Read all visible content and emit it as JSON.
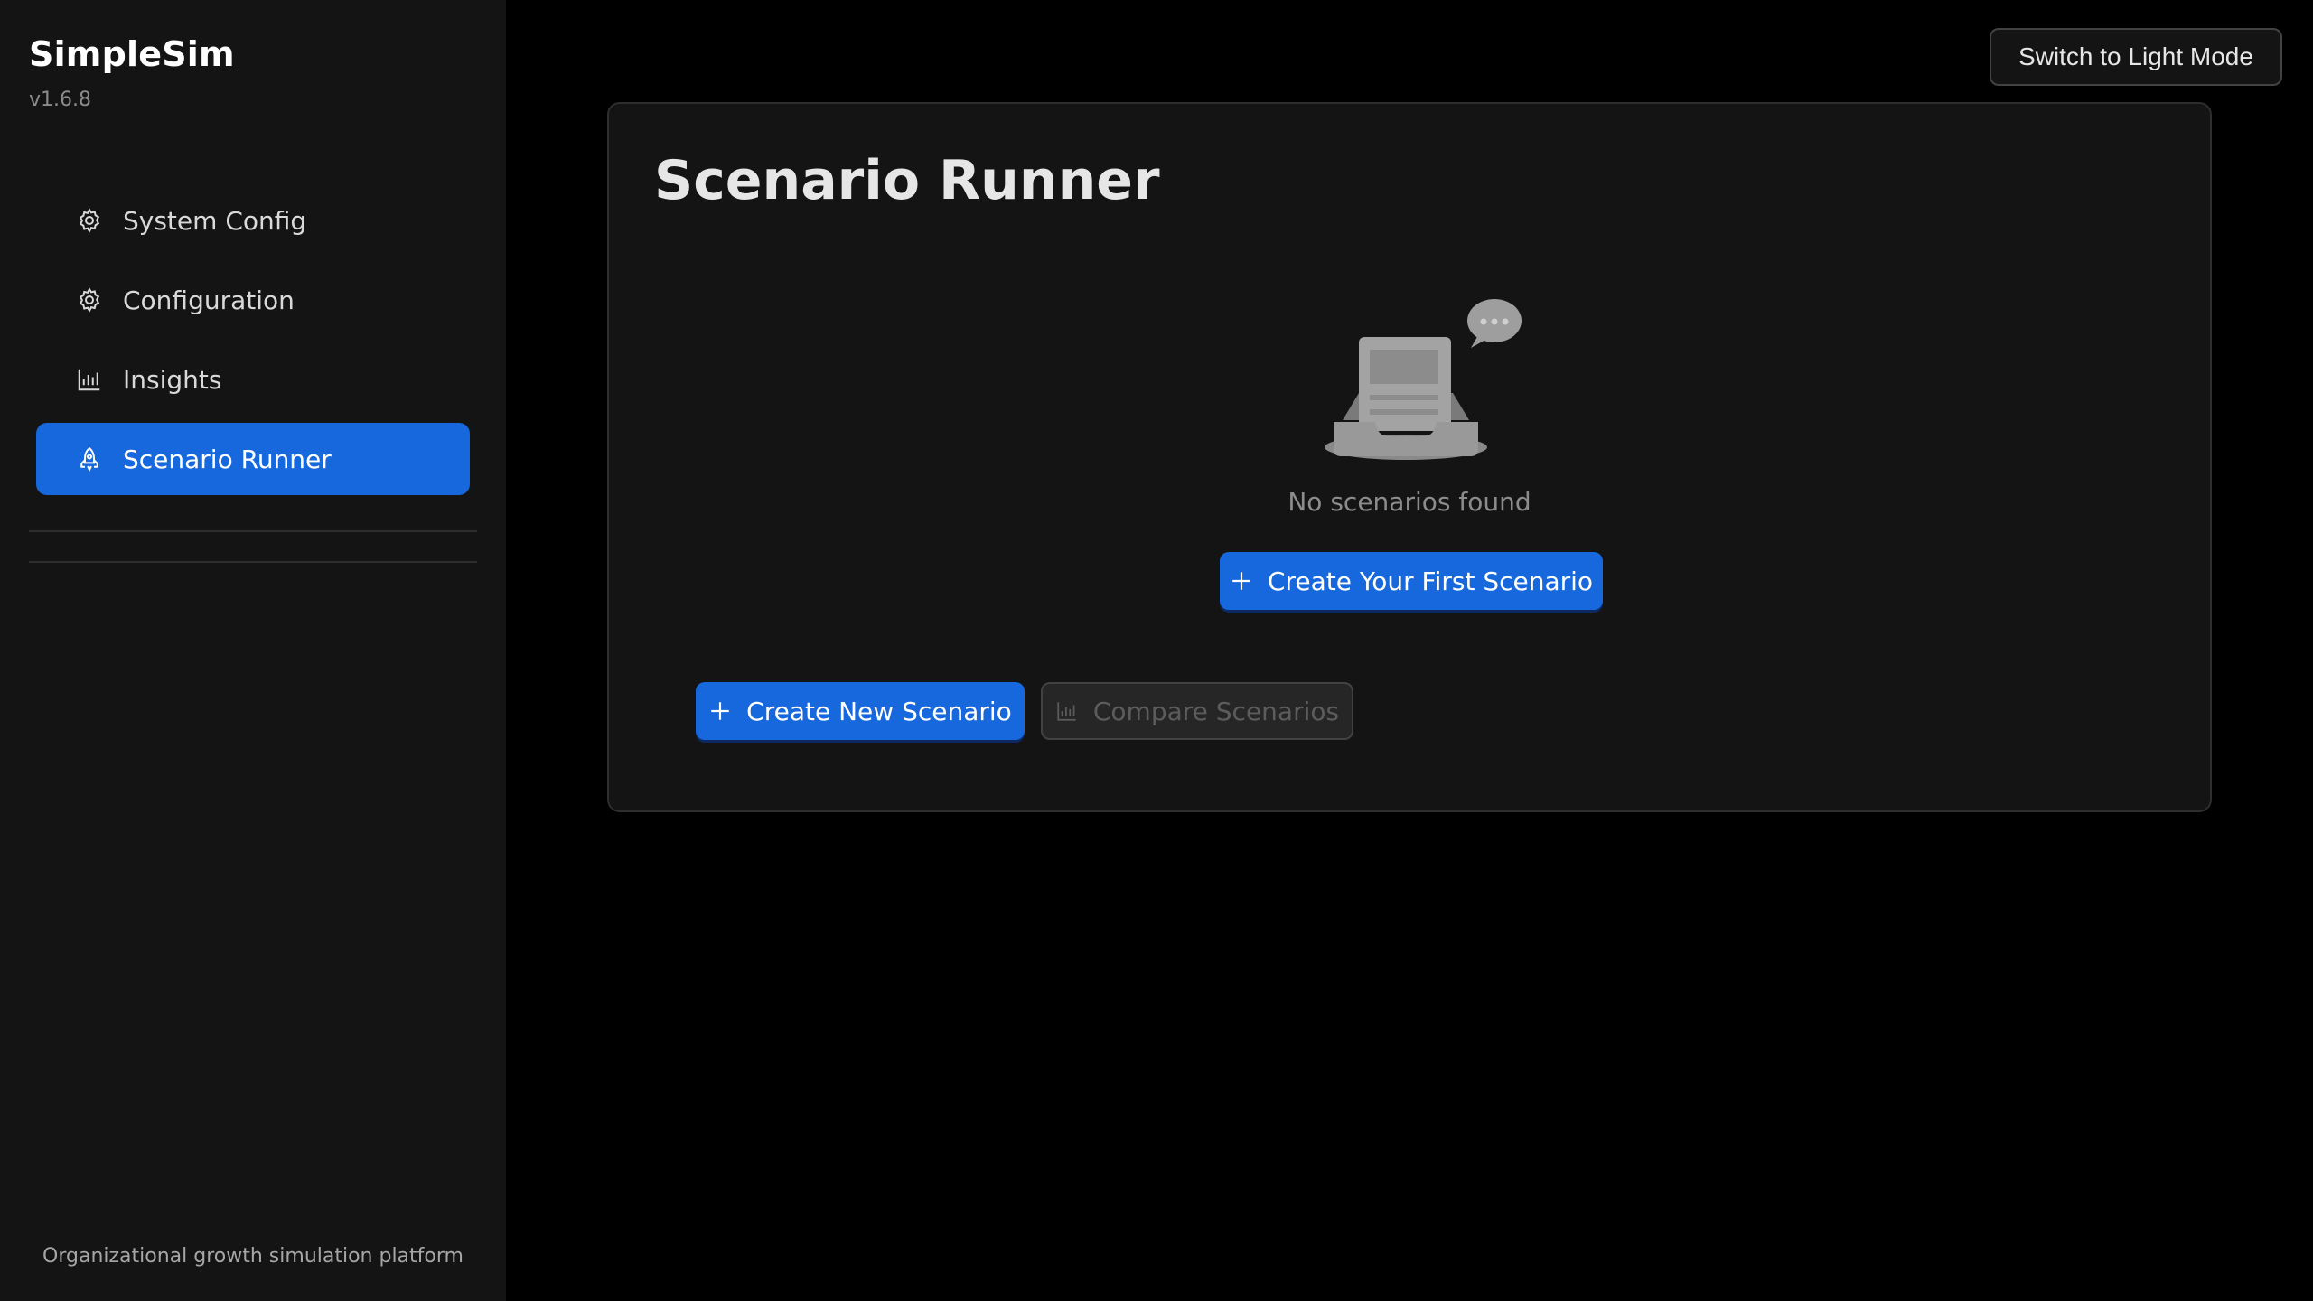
{
  "app": {
    "name": "SimpleSim",
    "version": "v1.6.8",
    "tagline": "Organizational growth simulation platform"
  },
  "sidebar": {
    "items": [
      {
        "label": "System Config",
        "icon": "gear-icon",
        "active": false
      },
      {
        "label": "Configuration",
        "icon": "gear-icon",
        "active": false
      },
      {
        "label": "Insights",
        "icon": "bar-chart-icon",
        "active": false
      },
      {
        "label": "Scenario Runner",
        "icon": "rocket-icon",
        "active": true
      }
    ]
  },
  "header": {
    "theme_toggle_label": "Switch to Light Mode"
  },
  "main": {
    "title": "Scenario Runner",
    "empty_state": {
      "text": "No scenarios found",
      "cta_label": "Create Your First Scenario",
      "illustration": "empty-inbox-icon"
    },
    "actions": {
      "create_label": "Create New Scenario",
      "compare_label": "Compare Scenarios"
    }
  },
  "colors": {
    "accent": "#1668dc",
    "background": "#000000",
    "sidebar": "#141414",
    "card": "#141414"
  }
}
